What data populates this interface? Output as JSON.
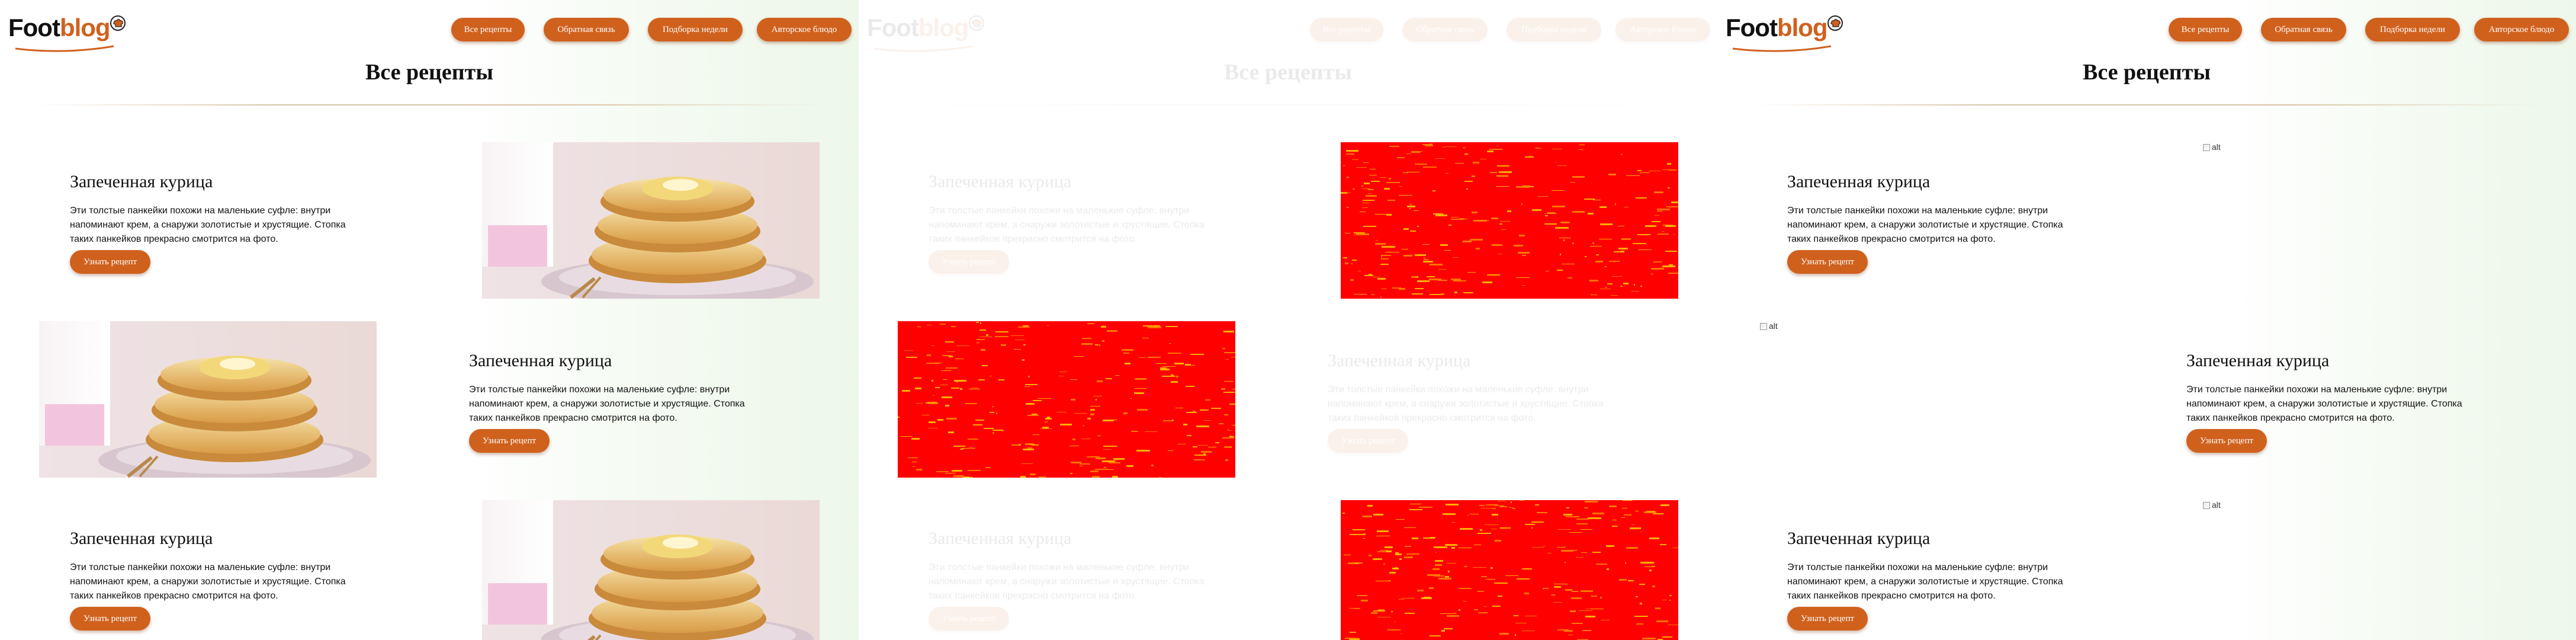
{
  "site": {
    "logo_main": "Foot",
    "logo_accent": "blog",
    "logo_icon": "chef-hat-icon"
  },
  "nav": [
    "Все рецепты",
    "Обратная связь",
    "Подборка недели",
    "Авторское блюдо"
  ],
  "page_title": "Все рецепты",
  "recipe": {
    "title": "Запеченная курица",
    "description": "Эти толстые панкейки похожи на маленькие суфле: внутри напоминают крем, а снаружи золотистые и хрустящие. Стопка таких панкейков прекрасно смотрится на фото.",
    "button": "Узнать рецепт",
    "image_alt": "alt"
  },
  "colors": {
    "accent": "#d0611d",
    "noise": "#ff0000"
  }
}
